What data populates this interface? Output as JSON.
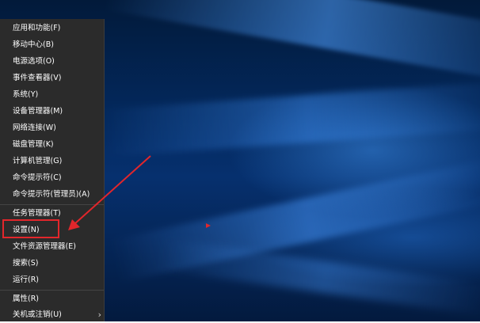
{
  "context_menu": {
    "groups": [
      [
        {
          "label": "应用和功能(F)"
        },
        {
          "label": "移动中心(B)"
        },
        {
          "label": "电源选项(O)"
        },
        {
          "label": "事件查看器(V)"
        },
        {
          "label": "系统(Y)"
        },
        {
          "label": "设备管理器(M)"
        },
        {
          "label": "网络连接(W)"
        },
        {
          "label": "磁盘管理(K)"
        },
        {
          "label": "计算机管理(G)"
        },
        {
          "label": "命令提示符(C)"
        },
        {
          "label": "命令提示符(管理员)(A)"
        }
      ],
      [
        {
          "label": "任务管理器(T)"
        },
        {
          "label": "设置(N)"
        },
        {
          "label": "文件资源管理器(E)"
        },
        {
          "label": "搜索(S)"
        },
        {
          "label": "运行(R)"
        }
      ],
      [
        {
          "label": "属性(R)"
        },
        {
          "label": "关机或注销(U)",
          "submenu_icon": "chevron-right-icon"
        }
      ]
    ]
  },
  "annotation": {
    "highlighted_item": "设置(N)",
    "color": "#e2262b"
  },
  "colors": {
    "menu_background": "#2b2b2b",
    "menu_text": "#ffffff",
    "desktop_accent": "#0a4fa3"
  }
}
